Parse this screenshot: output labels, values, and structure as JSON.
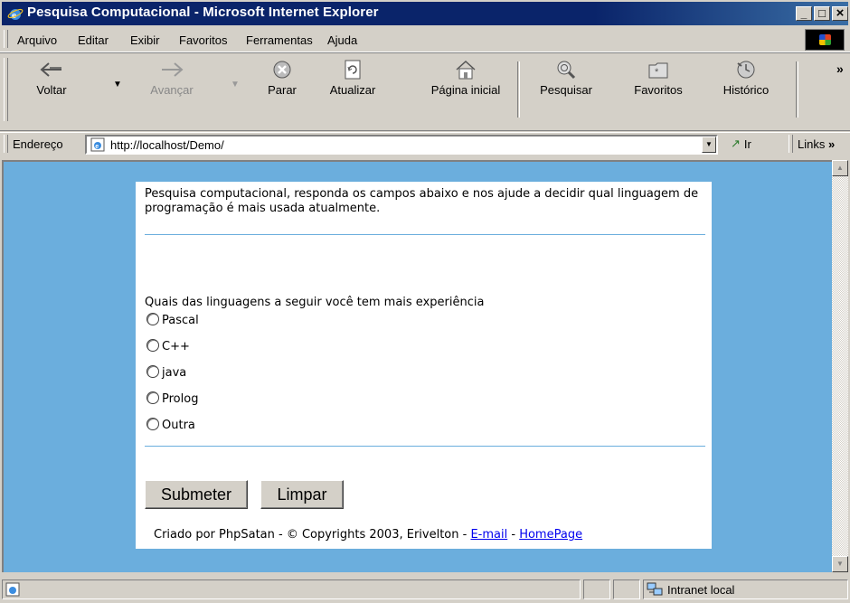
{
  "window": {
    "title": "Pesquisa Computacional - Microsoft Internet Explorer",
    "controls": {
      "minimize": "_",
      "maximize": "□",
      "close": "×"
    }
  },
  "menu": [
    "Arquivo",
    "Editar",
    "Exibir",
    "Favoritos",
    "Ferramentas",
    "Ajuda"
  ],
  "toolbar": {
    "back": "Voltar",
    "forward": "Avançar",
    "stop": "Parar",
    "refresh": "Atualizar",
    "home": "Página inicial",
    "search": "Pesquisar",
    "favorites": "Favoritos",
    "history": "Histórico",
    "more": "»"
  },
  "address": {
    "label": "Endereço",
    "url": "http://localhost/Demo/",
    "go": "Ir",
    "links": "Links"
  },
  "page": {
    "intro": "Pesquisa computacional, responda os campos abaixo e nos ajude a decidir qual linguagem de programação é mais usada atualmente.",
    "question": "Quais das linguagens a seguir você tem mais experiência",
    "options": [
      "Pascal",
      "C++",
      "java",
      "Prolog",
      "Outra"
    ],
    "submit": "Submeter",
    "reset": "Limpar",
    "footer_text": "Criado por PhpSatan - © Copyrights 2003, Erivelton - ",
    "footer_sep": " - ",
    "email_link": "E-mail",
    "home_link": "HomePage"
  },
  "status": {
    "zone": "Intranet local"
  },
  "colors": {
    "titlebar": "#0a246a",
    "page_bg": "#6baedd",
    "chrome": "#d4d0c8",
    "link": "#0000ee"
  }
}
